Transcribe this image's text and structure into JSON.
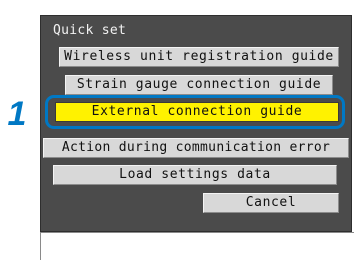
{
  "step_number": "1",
  "dialog": {
    "title": "Quick set",
    "items": [
      {
        "label": "Wireless unit registration guide",
        "selected": false
      },
      {
        "label": "Strain gauge connection guide",
        "selected": false
      },
      {
        "label": "External connection guide",
        "selected": true
      },
      {
        "label": "Action during communication error",
        "selected": false
      },
      {
        "label": "Load settings data",
        "selected": false
      }
    ],
    "cancel_label": "Cancel"
  },
  "colors": {
    "dialog_background": "#4b4b4b",
    "button_background": "#d8d8d8",
    "selected_background": "#fff200",
    "highlight_ring": "#0078c4",
    "step_number": "#0078c4"
  }
}
